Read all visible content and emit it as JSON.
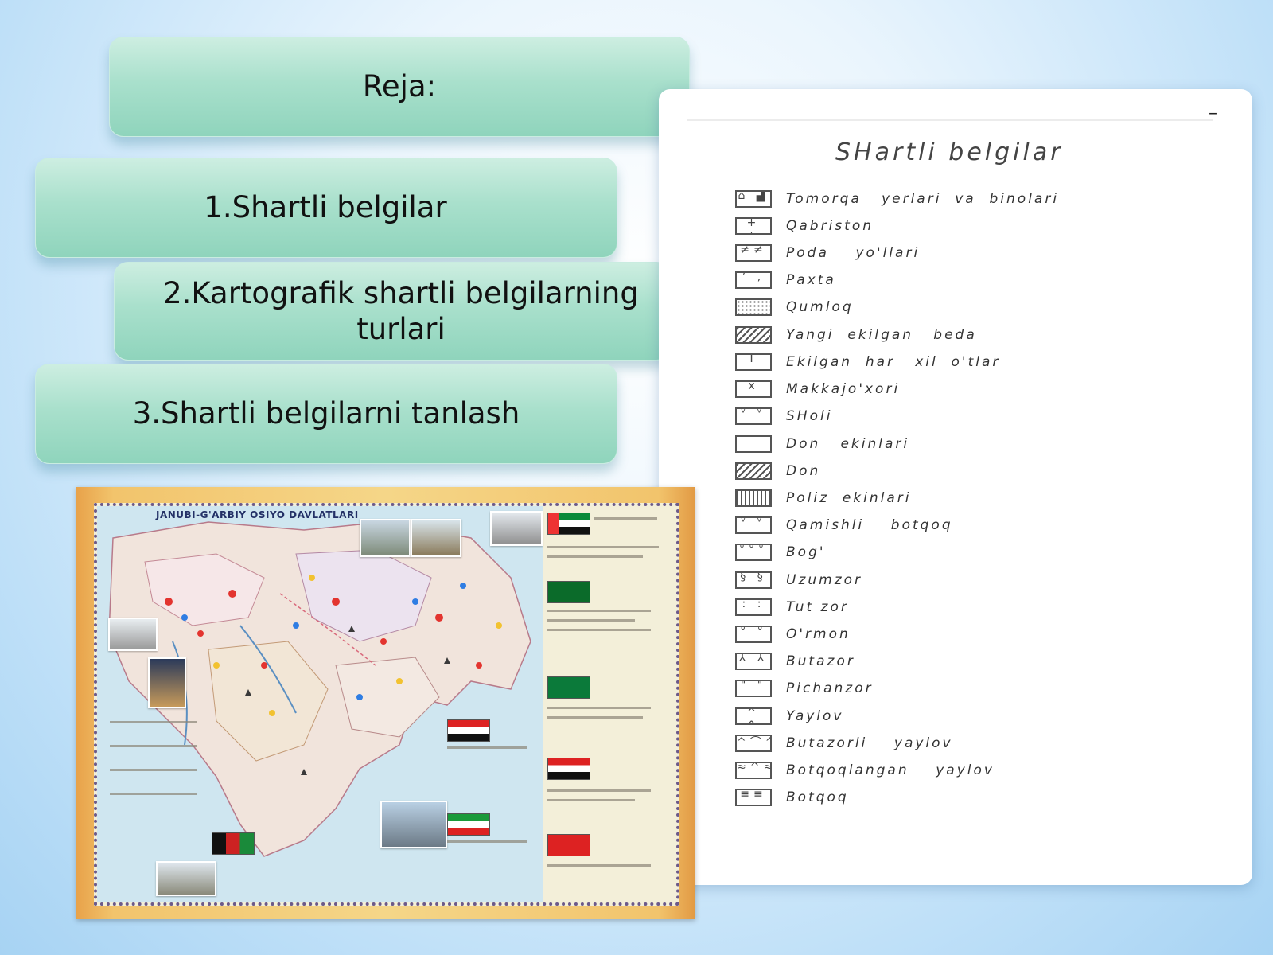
{
  "plan": {
    "title": "Reja:",
    "items": [
      "1.Shartli belgilar",
      "2.Kartografik shartli belgilarning turlari",
      "3.Shartli belgilarni tanlash"
    ]
  },
  "legend": {
    "title": "SHartli   belgilar",
    "corner_mark": "–",
    "items": [
      {
        "symbol": "gardens-buildings-icon",
        "label": "Tomorqa   yerlari  va  binolari"
      },
      {
        "symbol": "cemetery-icon",
        "label": "Qabriston"
      },
      {
        "symbol": "cattle-roads-icon",
        "label": "Poda    yo'llari"
      },
      {
        "symbol": "cotton-icon",
        "label": "Paxta"
      },
      {
        "symbol": "sand-icon",
        "label": "Qumloq"
      },
      {
        "symbol": "alfalfa-new-icon",
        "label": "Yangi  ekilgan   beda"
      },
      {
        "symbol": "mixed-grass-icon",
        "label": "Ekilgan  har   xil  o'tlar"
      },
      {
        "symbol": "corn-icon",
        "label": "Makkajo'xori"
      },
      {
        "symbol": "rice-icon",
        "label": "SHoli"
      },
      {
        "symbol": "grain-crops-icon",
        "label": "Don   ekinlari"
      },
      {
        "symbol": "grain-icon",
        "label": "Don"
      },
      {
        "symbol": "melon-crops-icon",
        "label": "Poliz  ekinlari"
      },
      {
        "symbol": "reed-swamp-icon",
        "label": "Qamishli    botqoq"
      },
      {
        "symbol": "orchard-icon",
        "label": "Bog'"
      },
      {
        "symbol": "vineyard-icon",
        "label": "Uzumzor"
      },
      {
        "symbol": "mulberry-icon",
        "label": "Tut zor"
      },
      {
        "symbol": "forest-icon",
        "label": "O'rmon"
      },
      {
        "symbol": "shrubs-icon",
        "label": "Butazor"
      },
      {
        "symbol": "hayfield-icon",
        "label": "Pichanzor"
      },
      {
        "symbol": "pasture-icon",
        "label": "Yaylov"
      },
      {
        "symbol": "shrub-pasture-icon",
        "label": "Butazorli    yaylov"
      },
      {
        "symbol": "swampy-pasture-icon",
        "label": "Botqoqlangan    yaylov"
      },
      {
        "symbol": "swamp-icon",
        "label": "Botqoq"
      }
    ]
  },
  "atlas": {
    "title": "JANUBI-G'ARBIY OSIYO DAVLATLARI",
    "colors": {
      "frame": "#e8a24a",
      "sea": "#cfe6f0",
      "land": "#f1e4dc"
    }
  }
}
